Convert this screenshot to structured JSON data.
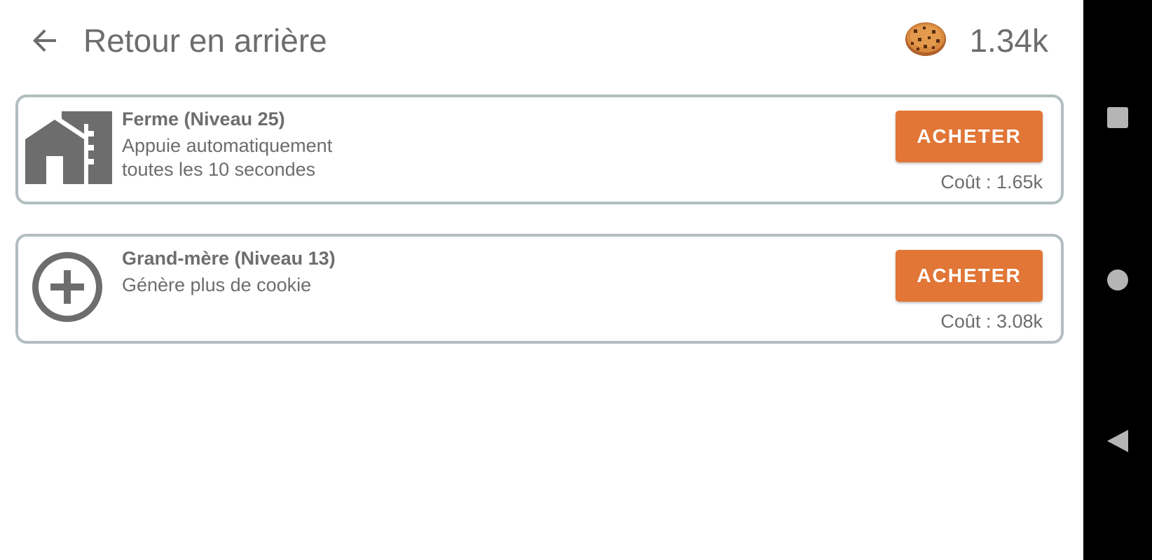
{
  "header": {
    "title": "Retour en arrière",
    "cookie_count": "1.34k"
  },
  "upgrades": [
    {
      "title": "Ferme (Niveau 25)",
      "description_lines": [
        "Appuie automatiquement",
        "toutes les 10 secondes"
      ],
      "buy_label": "ACHETER",
      "cost": "Coût : 1.65k",
      "icon": "farm-building-icon"
    },
    {
      "title": "Grand-mère (Niveau 13)",
      "description_lines": [
        "Génère plus de cookie"
      ],
      "buy_label": "ACHETER",
      "cost": "Coût : 3.08k",
      "icon": "add-circle-icon"
    }
  ],
  "system_nav": {
    "icons": [
      "recents-square-icon",
      "home-circle-icon",
      "back-triangle-icon"
    ]
  },
  "colors": {
    "accent": "#e17636",
    "text": "#6d6d6d",
    "card_border": "#b2bec0",
    "navbar_bg": "#000000"
  }
}
